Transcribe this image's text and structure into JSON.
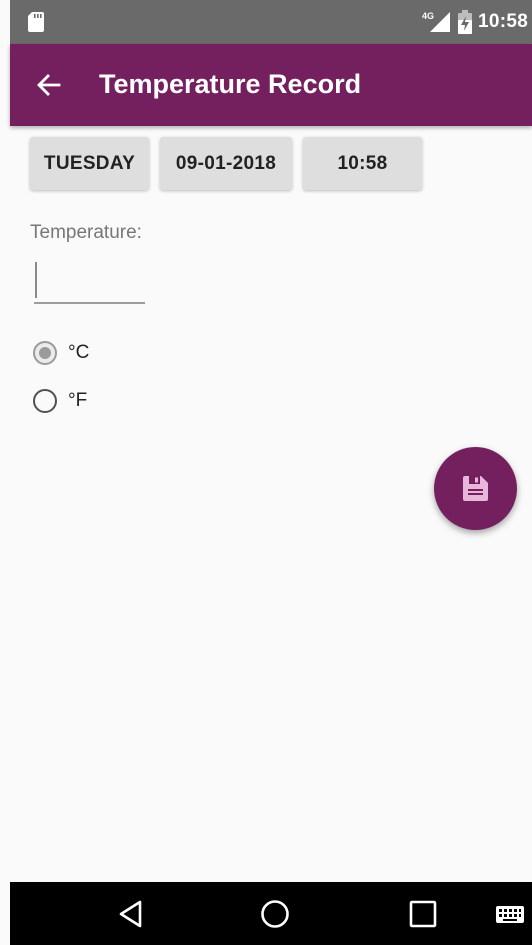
{
  "status_bar": {
    "time": "10:58",
    "network": "4G",
    "icons": [
      "sd-card-icon",
      "signal-icon",
      "battery-charging-icon"
    ]
  },
  "app_bar": {
    "title": "Temperature Record",
    "back_icon": "arrow-left-icon"
  },
  "datetime": {
    "day": "TUESDAY",
    "date": "09-01-2018",
    "time": "10:58"
  },
  "temperature": {
    "label": "Temperature:",
    "value": "",
    "placeholder": ""
  },
  "units": {
    "options": [
      {
        "label": "°C",
        "checked": true
      },
      {
        "label": "°F",
        "checked": false
      }
    ]
  },
  "fab": {
    "icon": "save-icon"
  },
  "nav_bar": {
    "icons": [
      "back-triangle-icon",
      "home-circle-icon",
      "recents-square-icon",
      "keyboard-icon"
    ]
  },
  "colors": {
    "primary": "#74205f",
    "status_bar": "#6a6a6a",
    "background": "#fafafa",
    "chip": "#dedede",
    "nav_bar": "#000000"
  }
}
